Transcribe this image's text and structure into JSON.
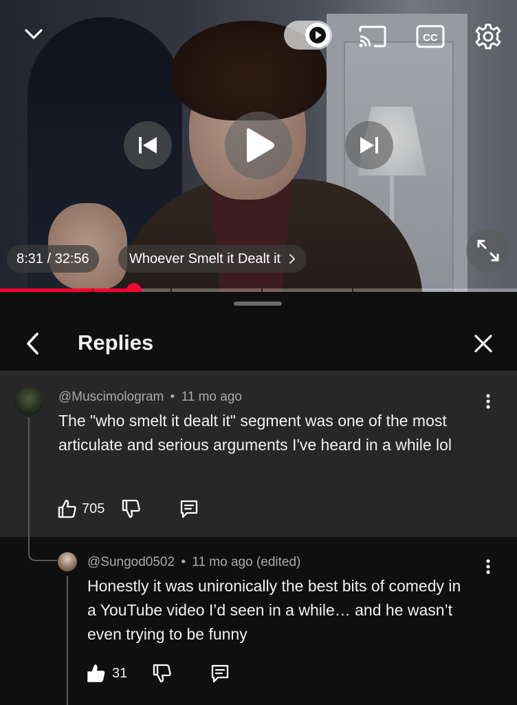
{
  "player": {
    "current_time": "8:31",
    "duration": "32:56",
    "time_text": "8:31 / 32:56",
    "chapter_title": "Whoever Smelt it Dealt it",
    "progress_fraction": 0.259,
    "autoplay": "on"
  },
  "icons": {
    "collapse": "chevron-down-icon",
    "autoplay": "autoplay-toggle-icon",
    "cast": "cast-icon",
    "captions": "cc-icon",
    "settings": "gear-icon",
    "previous": "skip-previous-icon",
    "play": "play-icon",
    "next": "skip-next-icon",
    "fullscreen": "fullscreen-icon"
  },
  "captions_label": "CC",
  "panel": {
    "title": "Replies"
  },
  "comments": {
    "parent": {
      "author": "@Muscimologram",
      "separator": "•",
      "age": "11 mo ago",
      "text": "The \"who smelt it dealt it\" segment was one of the most articulate and serious arguments I've heard in a while lol",
      "likes": "705",
      "liked": false
    },
    "reply": {
      "author": "@Sungod0502",
      "separator": "•",
      "age": "11 mo ago (edited)",
      "text": "Honestly it was unironically the best bits of comedy in a YouTube video I’d seen in a while… and he wasn’t even trying to be funny",
      "likes": "31",
      "liked": true
    }
  },
  "colors": {
    "accent_red": "#ff0033",
    "background": "#0f0f0f",
    "highlighted_comment": "#272727",
    "secondary_text": "#aaaaaa",
    "primary_text": "#f1f1f1"
  }
}
